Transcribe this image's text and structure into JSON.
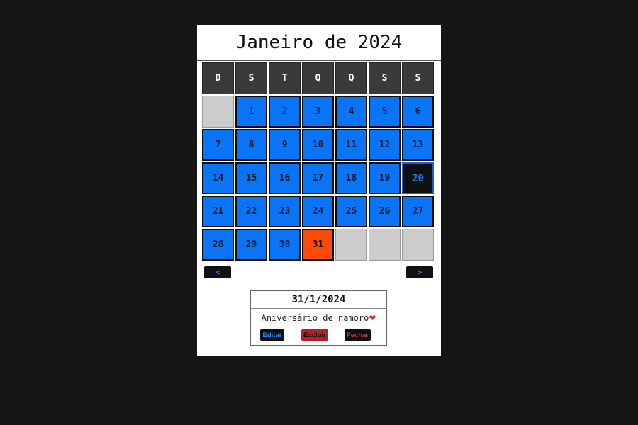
{
  "calendar": {
    "title": "Janeiro de 2024",
    "weekdays": [
      "D",
      "S",
      "T",
      "Q",
      "Q",
      "S",
      "S"
    ],
    "days": [
      "1",
      "2",
      "3",
      "4",
      "5",
      "6",
      "7",
      "8",
      "9",
      "10",
      "11",
      "12",
      "13",
      "14",
      "15",
      "16",
      "17",
      "18",
      "19",
      "20",
      "21",
      "22",
      "23",
      "24",
      "25",
      "26",
      "27",
      "28",
      "29",
      "30",
      "31"
    ],
    "today": "20",
    "selected": "31"
  },
  "nav": {
    "prev_label": "<",
    "next_label": ">"
  },
  "event": {
    "date": "31/1/2024",
    "description": "Aniversário de namoro",
    "description_icon": "heart-icon",
    "edit_label": "Editar",
    "delete_label": "Excluir",
    "close_label": "Fechar"
  },
  "colors": {
    "day_default": "#0a74f6",
    "day_today_bg": "#101010",
    "day_selected": "#ff4a0a",
    "header_bg": "#3a3a3a",
    "empty_cell": "#cccccc"
  }
}
